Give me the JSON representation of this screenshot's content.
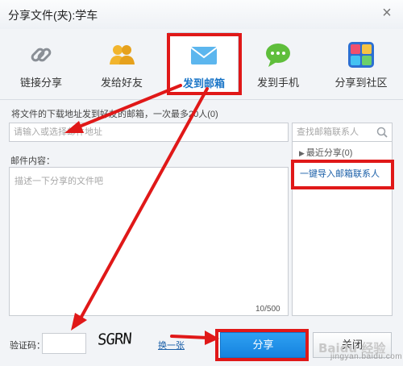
{
  "window": {
    "title": "分享文件(夹):学车"
  },
  "tabs": [
    {
      "label": "链接分享",
      "icon": "link-icon"
    },
    {
      "label": "发给好友",
      "icon": "friends-icon"
    },
    {
      "label": "发到邮箱",
      "icon": "mail-icon",
      "active": true
    },
    {
      "label": "发到手机",
      "icon": "chat-bubble-icon"
    },
    {
      "label": "分享到社区",
      "icon": "community-icon"
    }
  ],
  "email": {
    "hint": "将文件的下载地址发到好友的邮箱，一次最多20人(0)",
    "placeholder": "请输入或选择邮件地址"
  },
  "contacts": {
    "search_placeholder": "查找邮箱联系人",
    "recent": "最近分享(0)",
    "import_link": "一键导入邮箱联系人"
  },
  "content": {
    "label": "邮件内容：",
    "placeholder": "描述一下分享的文件吧",
    "counter": "10/500"
  },
  "captcha": {
    "label": "验证码：",
    "code": "SGRN",
    "refresh": "换一张"
  },
  "buttons": {
    "share": "分享",
    "close": "关闭"
  },
  "watermark": {
    "text": "Baidu 经验",
    "url_text": "jingyan.baidu.com"
  },
  "colors": {
    "accent": "#1a75c7",
    "annotation": "#e01818",
    "share_button": "#1e8fe8"
  }
}
